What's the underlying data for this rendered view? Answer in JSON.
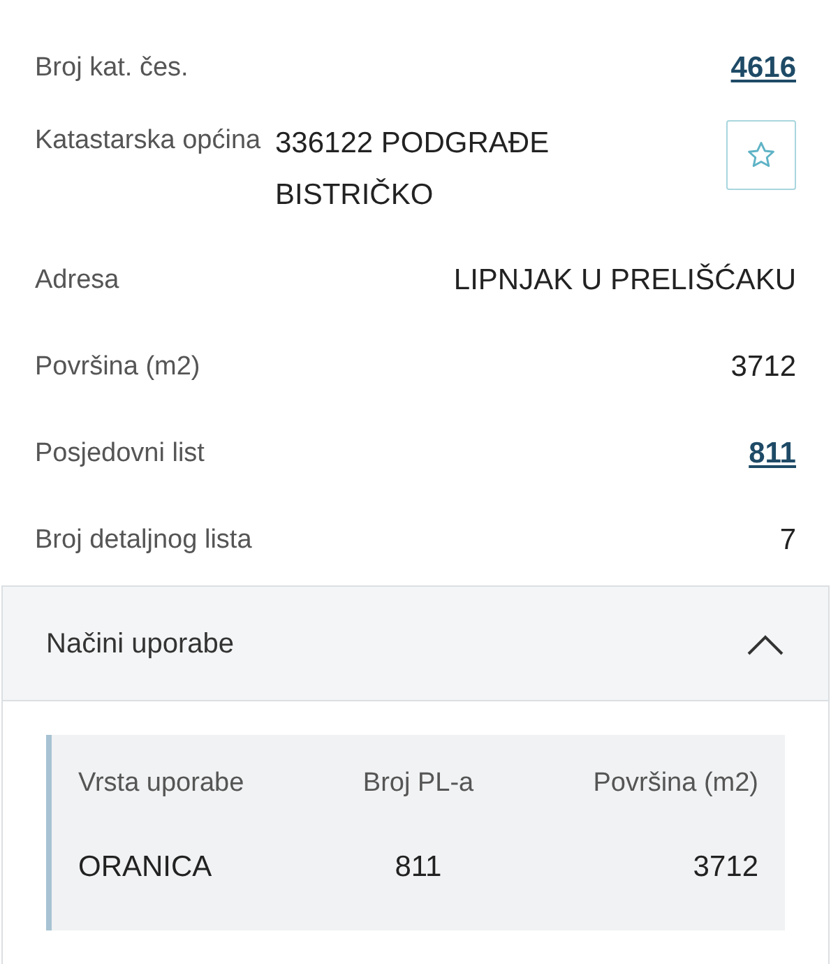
{
  "parcel_fields": [
    {
      "label": "Broj kat. čes.",
      "value": "4616",
      "kind": "link"
    },
    {
      "label": "Katastarska općina",
      "value": "336122 PODGRAĐE BISTRIČKO",
      "kind": "favorite"
    },
    {
      "label": "Adresa",
      "value": "LIPNJAK U PRELIŠĆAKU",
      "kind": "text"
    },
    {
      "label": "Površina (m2)",
      "value": "3712",
      "kind": "text"
    },
    {
      "label": "Posjedovni list",
      "value": "811",
      "kind": "link"
    },
    {
      "label": "Broj detaljnog lista",
      "value": "7",
      "kind": "text"
    }
  ],
  "usage_section": {
    "title": "Načini uporabe",
    "expanded": true,
    "table": {
      "columns": [
        "Vrsta uporabe",
        "Broj PL-a",
        "Površina (m2)"
      ],
      "rows": [
        [
          "ORANICA",
          "811",
          "3712"
        ]
      ]
    }
  }
}
